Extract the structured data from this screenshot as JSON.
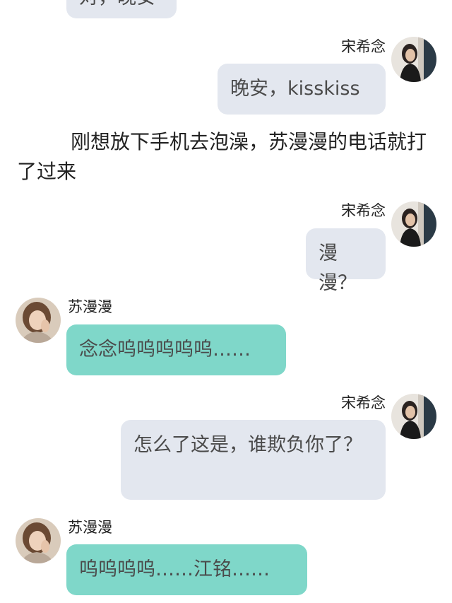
{
  "chat": {
    "top_partial_message": "对，晚安",
    "names": {
      "self": "宋希念",
      "other": "苏漫漫"
    },
    "messages": [
      {
        "sender": "self",
        "text": "晚安，kisskiss"
      },
      {
        "sender": "self",
        "text": "漫漫？"
      },
      {
        "sender": "other",
        "text": "念念呜呜呜呜呜……"
      },
      {
        "sender": "self",
        "text": "怎么了这是，谁欺负你了？"
      },
      {
        "sender": "other",
        "text": "呜呜呜呜……江铭……"
      }
    ],
    "narration": "刚想放下手机去泡澡，苏漫漫的电话就打了过来"
  },
  "colors": {
    "self_bubble": "#e3e7ef",
    "other_bubble": "#7fd7c9",
    "background": "#ffffff"
  },
  "icons": {
    "self_avatar": "avatar-photo-woman-dark-hair",
    "other_avatar": "avatar-photo-woman-light-hair"
  }
}
